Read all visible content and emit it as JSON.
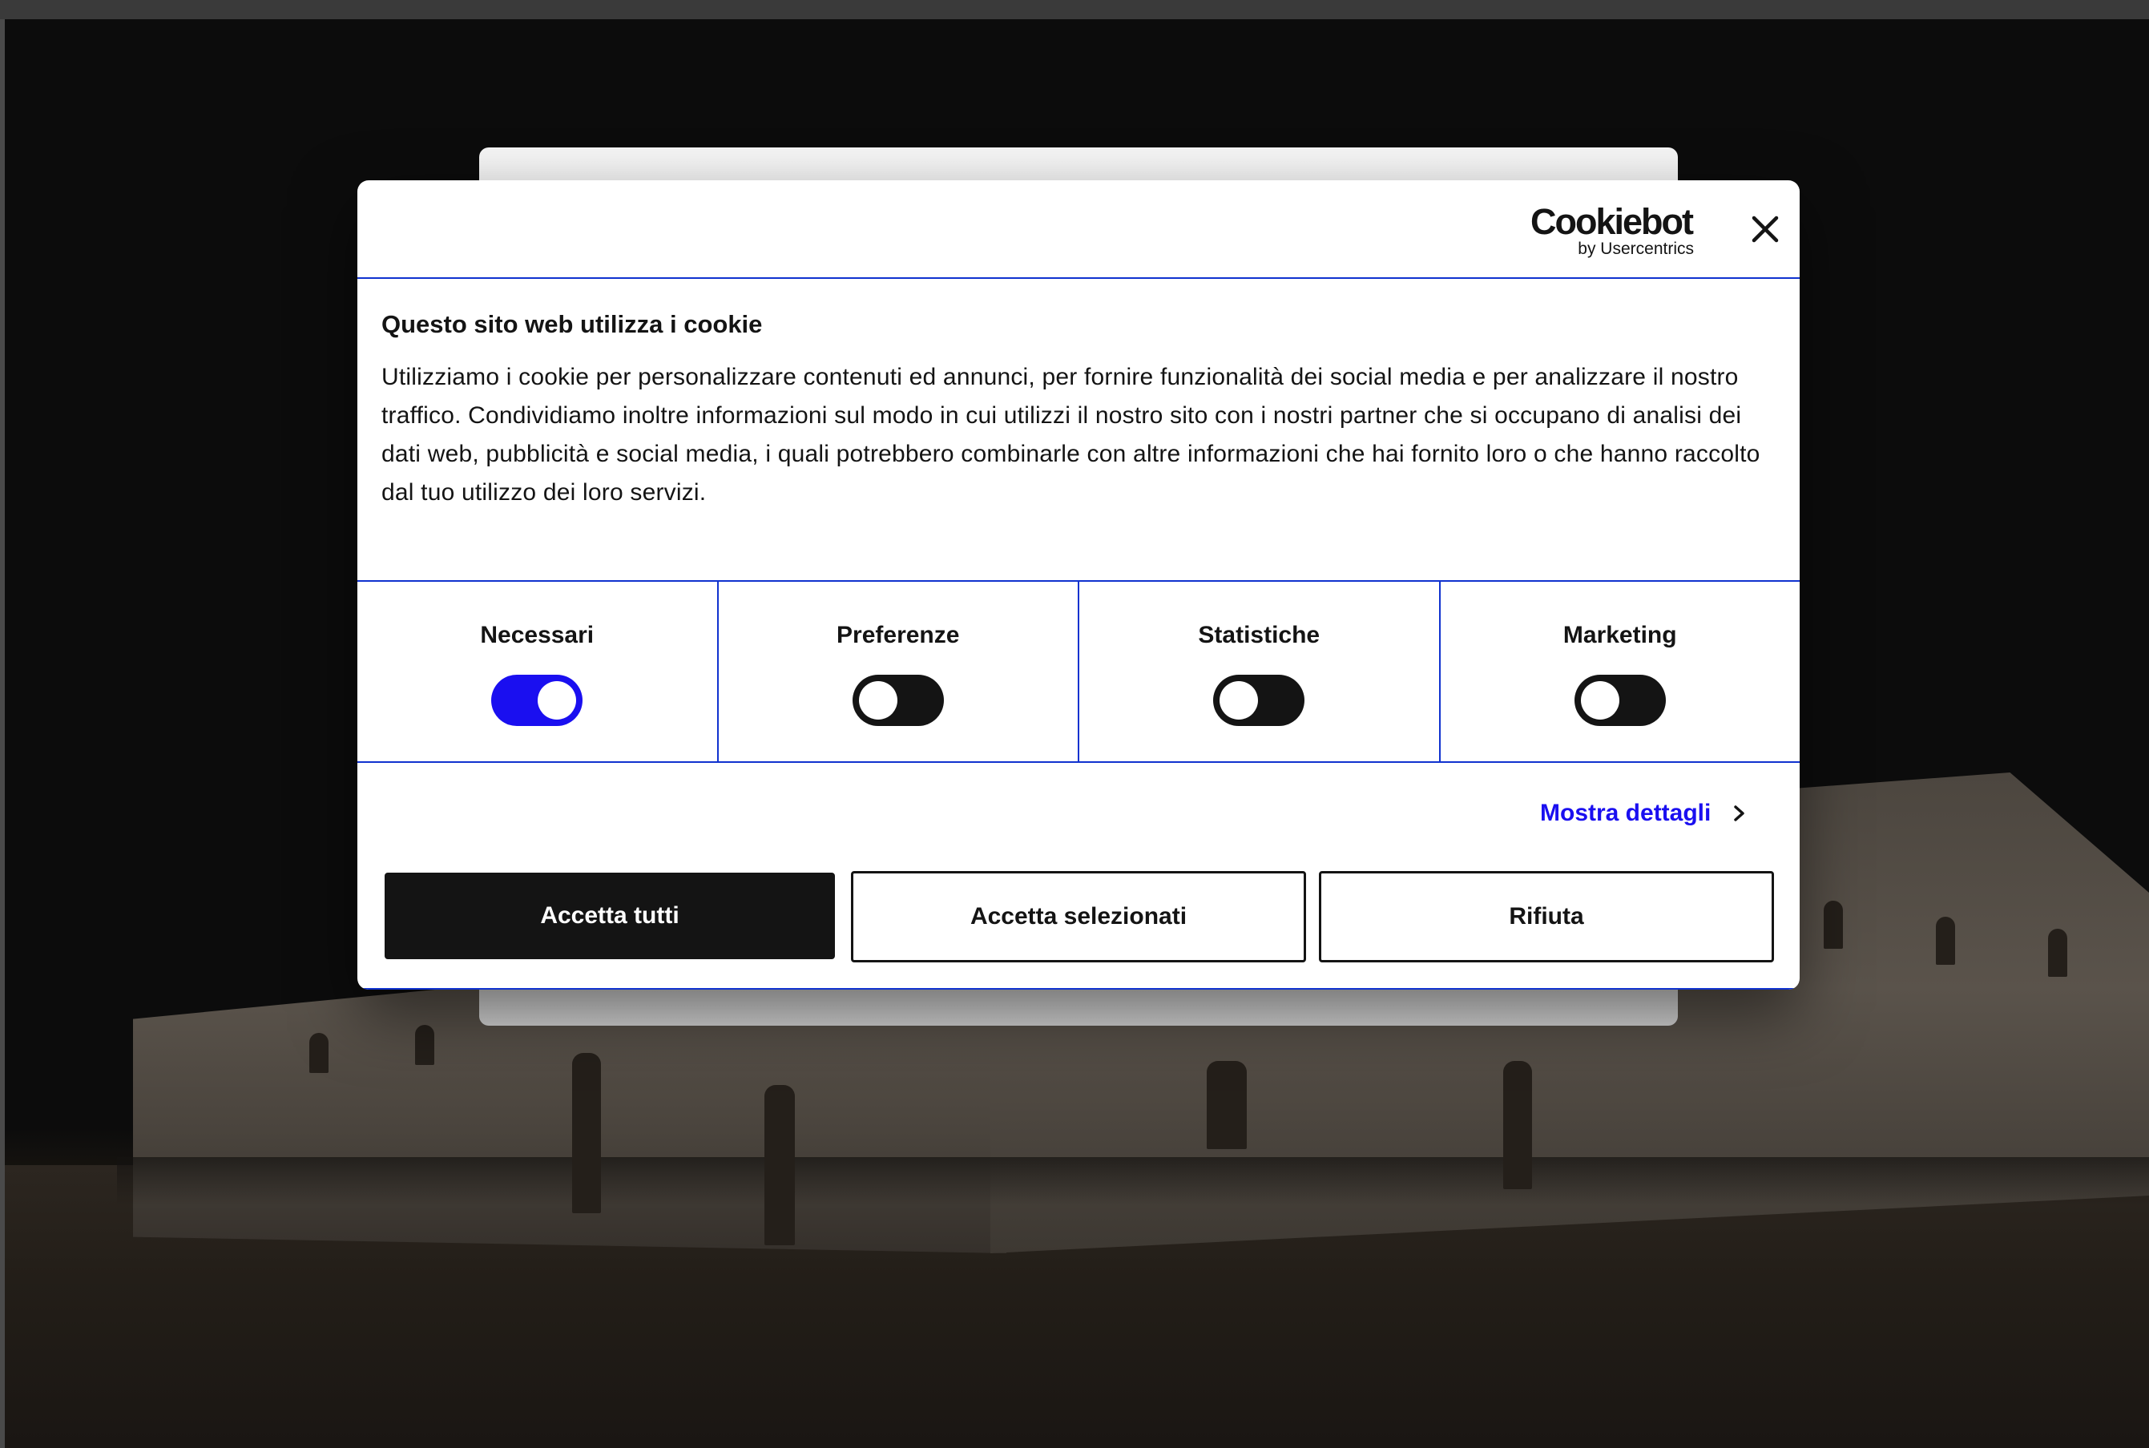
{
  "dialog": {
    "brand": {
      "logo_text": "Cookiebot",
      "logo_sub": "by Usercentrics"
    },
    "close_icon": "close-icon",
    "title": "Questo sito web utilizza i cookie",
    "description": "Utilizziamo i cookie per personalizzare contenuti ed annunci, per fornire funzionalità dei social media e per analizzare il nostro traffico. Condividiamo inoltre informazioni sul modo in cui utilizzi il nostro sito con i nostri partner che si occupano di analisi dei dati web, pubblicità e social media, i quali potrebbero combinarle con altre informazioni che hai fornito loro o che hanno raccolto dal tuo utilizzo dei loro servizi.",
    "toggles": [
      {
        "label": "Necessari",
        "enabled": true
      },
      {
        "label": "Preferenze",
        "enabled": false
      },
      {
        "label": "Statistiche",
        "enabled": false
      },
      {
        "label": "Marketing",
        "enabled": false
      }
    ],
    "details_link": "Mostra dettagli",
    "buttons": {
      "accept_all": "Accetta tutti",
      "accept_selected": "Accetta selezionati",
      "reject": "Rifiuta"
    }
  },
  "colors": {
    "accent": "#1a0ff0",
    "divider": "#1032cf",
    "primary_button": "#141414"
  }
}
